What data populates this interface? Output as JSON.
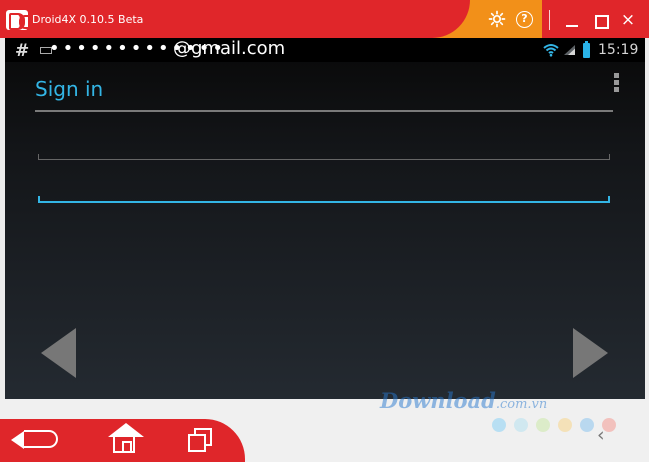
{
  "window": {
    "title": "Droid4X 0.10.5 Beta",
    "controls": {
      "settings_icon": "gear-icon",
      "help_symbol": "?",
      "close_symbol": "×"
    }
  },
  "status_bar": {
    "left_symbol": "#",
    "time": "15:19",
    "wifi_icon": "wifi-icon",
    "signal_icon": "signal-icon",
    "battery_icon": "battery-charging-icon",
    "colors": {
      "accent": "#33b5e5"
    }
  },
  "sign_in": {
    "title": "Sign in",
    "email_value": "@gmail.com",
    "password_mask": "•••••••••••••"
  },
  "navigation": {
    "previous_icon": "left-arrow-icon",
    "next_icon": "right-arrow-icon",
    "back_icon": "back-icon",
    "home_icon": "home-icon",
    "recent_apps_icon": "recent-apps-icon"
  },
  "watermark": {
    "brand": "Download",
    "domain": ".com.vn",
    "chevron": "‹"
  },
  "colors": {
    "title_bar_red": "#e0262a",
    "title_bar_orange": "#f29019",
    "screen_dark": "#131518",
    "field_accent": "#33b5e5"
  }
}
